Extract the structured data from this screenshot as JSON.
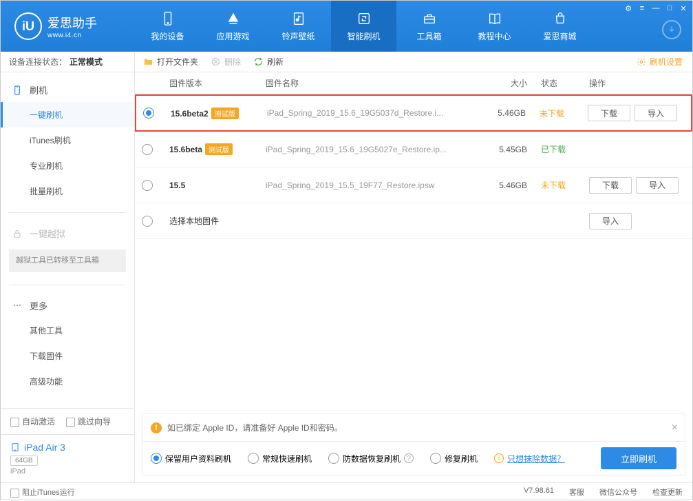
{
  "app": {
    "title": "爱思助手",
    "subtitle": "www.i4.cn"
  },
  "nav": {
    "items": [
      {
        "label": "我的设备"
      },
      {
        "label": "应用游戏"
      },
      {
        "label": "铃声壁纸"
      },
      {
        "label": "智能刷机"
      },
      {
        "label": "工具箱"
      },
      {
        "label": "教程中心"
      },
      {
        "label": "爱思商城"
      }
    ]
  },
  "sidebar": {
    "conn_label": "设备连接状态：",
    "conn_value": "正常模式",
    "flash_head": "刷机",
    "flash_items": [
      "一键刷机",
      "iTunes刷机",
      "专业刷机",
      "批量刷机"
    ],
    "jailbreak_head": "一键越狱",
    "jailbreak_note": "越狱工具已转移至工具箱",
    "more_head": "更多",
    "more_items": [
      "其他工具",
      "下载固件",
      "高级功能"
    ],
    "auto_activate": "自动激活",
    "skip_guide": "跳过向导",
    "device_name": "iPad Air 3",
    "device_storage": "64GB",
    "device_type": "iPad"
  },
  "toolbar": {
    "open_folder": "打开文件夹",
    "delete": "删除",
    "refresh": "刷新",
    "settings": "刷机设置"
  },
  "table": {
    "cols": {
      "version": "固件版本",
      "name": "固件名称",
      "size": "大小",
      "status": "状态",
      "action": "操作"
    },
    "rows": [
      {
        "selected": true,
        "version": "15.6beta2",
        "beta": "测试版",
        "name": "iPad_Spring_2019_15.6_19G5037d_Restore.i...",
        "size": "5.46GB",
        "status": "未下载",
        "status_class": "st-undl",
        "dl": "下载",
        "imp": "导入",
        "highlighted": true
      },
      {
        "selected": false,
        "version": "15.6beta",
        "beta": "测试版",
        "name": "iPad_Spring_2019_15.6_19G5027e_Restore.ip...",
        "size": "5.45GB",
        "status": "已下载",
        "status_class": "st-dl"
      },
      {
        "selected": false,
        "version": "15.5",
        "beta": "",
        "name": "iPad_Spring_2019_15.5_19F77_Restore.ipsw",
        "size": "5.46GB",
        "status": "未下载",
        "status_class": "st-undl",
        "dl": "下载",
        "imp": "导入"
      }
    ],
    "local_select": "选择本地固件",
    "local_import": "导入"
  },
  "notice": {
    "text": "如已绑定 Apple ID，请准备好 Apple ID和密码。",
    "opts": [
      "保留用户资料刷机",
      "常规快速刷机",
      "防数据恢复刷机",
      "修复刷机"
    ],
    "erase": "只想抹除数据？",
    "flash": "立即刷机"
  },
  "footer": {
    "block_itunes": "阻止iTunes运行",
    "version": "V7.98.61",
    "links": [
      "客服",
      "微信公众号",
      "检查更新"
    ]
  }
}
